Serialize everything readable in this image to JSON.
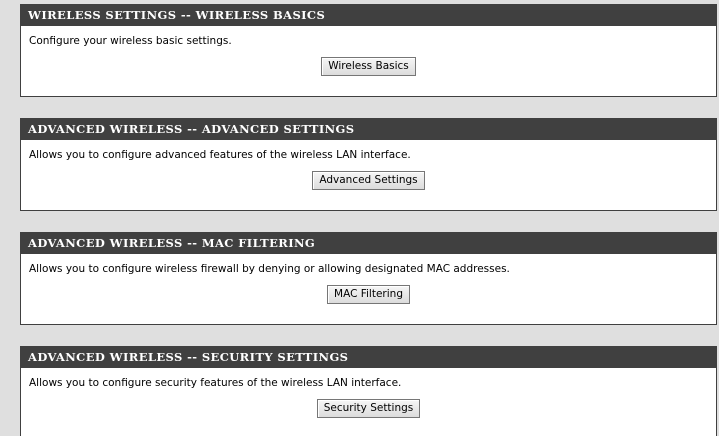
{
  "sections": [
    {
      "title": "WIRELESS SETTINGS -- WIRELESS BASICS",
      "description": "Configure your wireless basic settings.",
      "button_label": "Wireless Basics"
    },
    {
      "title": "ADVANCED WIRELESS -- ADVANCED SETTINGS",
      "description": "Allows you to configure advanced features of the wireless LAN interface.",
      "button_label": "Advanced Settings"
    },
    {
      "title": "ADVANCED WIRELESS -- MAC FILTERING",
      "description": "Allows you to configure wireless firewall by denying or allowing designated MAC addresses.",
      "button_label": "MAC Filtering"
    },
    {
      "title": "ADVANCED WIRELESS -- SECURITY SETTINGS",
      "description": "Allows you to configure security features of the wireless LAN interface.",
      "button_label": "Security Settings"
    }
  ],
  "colors": {
    "header_bg": "#404040",
    "header_text": "#ffffff",
    "page_bg": "#dfdfdf",
    "panel_bg": "#ffffff"
  }
}
